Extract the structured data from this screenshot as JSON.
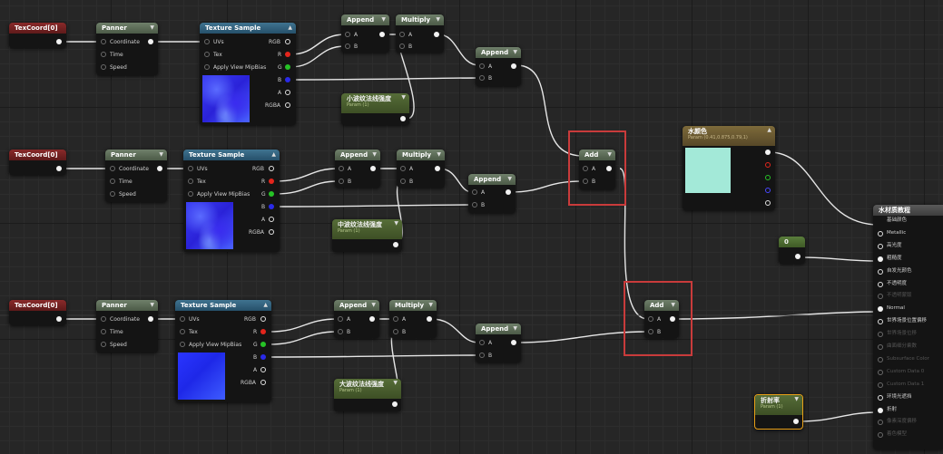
{
  "row1": {
    "texcoord": "TexCoord[0]",
    "panner": {
      "title": "Panner",
      "coordinate": "Coordinate",
      "time": "Time",
      "speed": "Speed"
    },
    "texture": {
      "title": "Texture Sample",
      "uvs": "UVs",
      "tex": "Tex",
      "mip": "Apply View MipBias",
      "rgb": "RGB",
      "r": "R",
      "g": "G",
      "b": "B",
      "a": "A",
      "rgba": "RGBA"
    },
    "append1": {
      "title": "Append",
      "a": "A",
      "b": "B"
    },
    "multiply": {
      "title": "Multiply",
      "a": "A",
      "b": "B"
    },
    "append2": {
      "title": "Append",
      "a": "A",
      "b": "B"
    },
    "param": {
      "title": "小波纹法线强度",
      "sub": "Param (1)"
    }
  },
  "row2": {
    "texcoord": "TexCoord[0]",
    "panner": {
      "title": "Panner",
      "coordinate": "Coordinate",
      "time": "Time",
      "speed": "Speed"
    },
    "texture": {
      "title": "Texture Sample",
      "uvs": "UVs",
      "tex": "Tex",
      "mip": "Apply View MipBias",
      "rgb": "RGB",
      "r": "R",
      "g": "G",
      "b": "B",
      "a": "A",
      "rgba": "RGBA"
    },
    "append1": {
      "title": "Append",
      "a": "A",
      "b": "B"
    },
    "multiply": {
      "title": "Multiply",
      "a": "A",
      "b": "B"
    },
    "append2": {
      "title": "Append",
      "a": "A",
      "b": "B"
    },
    "param": {
      "title": "中波纹法线强度",
      "sub": "Param (1)"
    }
  },
  "row3": {
    "texcoord": "TexCoord[0]",
    "panner": {
      "title": "Panner",
      "coordinate": "Coordinate",
      "time": "Time",
      "speed": "Speed"
    },
    "texture": {
      "title": "Texture Sample",
      "uvs": "UVs",
      "tex": "Tex",
      "mip": "Apply View MipBias",
      "rgb": "RGB",
      "r": "R",
      "g": "G",
      "b": "B",
      "a": "A",
      "rgba": "RGBA"
    },
    "append1": {
      "title": "Append",
      "a": "A",
      "b": "B"
    },
    "multiply": {
      "title": "Multiply",
      "a": "A",
      "b": "B"
    },
    "append2": {
      "title": "Append",
      "a": "A",
      "b": "B"
    },
    "param": {
      "title": "大波纹法线强度",
      "sub": "Param (1)"
    }
  },
  "add1": {
    "title": "Add",
    "a": "A",
    "b": "B"
  },
  "add2": {
    "title": "Add",
    "a": "A",
    "b": "B"
  },
  "water_color": {
    "title": "水颜色",
    "sub": "Param (0.41,0.875,0.79,1)",
    "swatch": "#a3e9d8"
  },
  "constant": {
    "title": "0"
  },
  "refraction": {
    "title": "折射率",
    "sub": "Param (1)"
  },
  "result": {
    "title": "水材质教程",
    "pins": [
      "基础颜色",
      "Metallic",
      "高光度",
      "粗糙度",
      "自发光颜色",
      "不透明度",
      "不透明蒙版",
      "Normal",
      "世界场景位置偏移",
      "世界场景位移",
      "曲面细分乘数",
      "Subsurface Color",
      "Custom Data 0",
      "Custom Data 1",
      "环境光遮挡",
      "折射",
      "像素深度偏移",
      "着色模型"
    ]
  },
  "colors": {
    "accent_selection": "#c93b3b",
    "wire": "#e8e8e8",
    "grid": "#262626"
  }
}
